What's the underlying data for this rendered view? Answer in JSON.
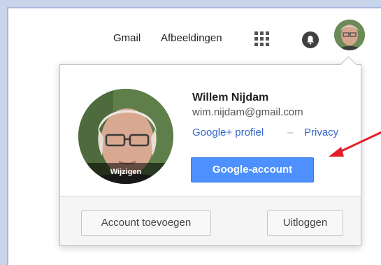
{
  "topbar": {
    "gmail_link": "Gmail",
    "images_link": "Afbeeldingen",
    "apps_icon": "apps-grid-icon",
    "notifications_icon": "bell-icon"
  },
  "account_popup": {
    "name": "Willem Nijdam",
    "email": "wim.nijdam@gmail.com",
    "profile_link": "Google+ profiel",
    "separator": "–",
    "privacy_link": "Privacy",
    "change_photo_label": "Wijzigen",
    "account_button": "Google-account",
    "add_account_button": "Account toevoegen",
    "logout_button": "Uitloggen"
  },
  "colors": {
    "primary_button": "#4d90fe",
    "link": "#3366cc",
    "annotation_arrow": "#e3202a"
  }
}
